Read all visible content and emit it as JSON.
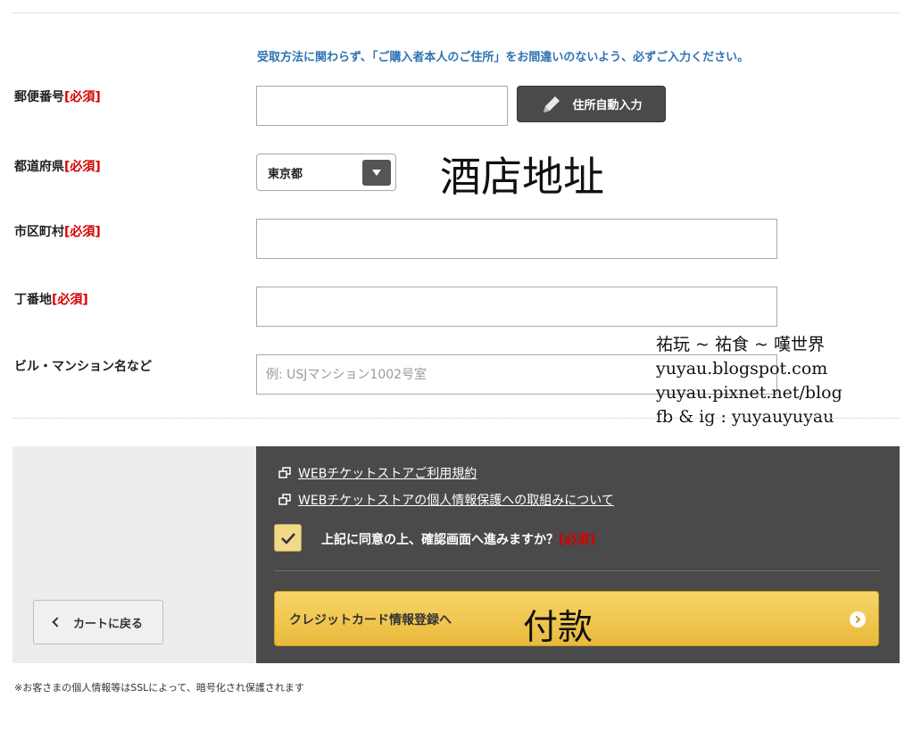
{
  "notice": "受取方法に関わらず、「ご購入者本人のご住所」をお間違いのないよう、必ずご入力ください。",
  "required_tag": "[必須]",
  "fields": {
    "postal": {
      "label": "郵便番号",
      "value": ""
    },
    "prefecture": {
      "label": "都道府県",
      "selected": "東京都"
    },
    "city": {
      "label": "市区町村",
      "value": ""
    },
    "street": {
      "label": "丁番地",
      "value": ""
    },
    "building": {
      "label": "ビル・マンション名など",
      "placeholder": "例: USJマンション1002号室",
      "value": ""
    }
  },
  "auto_fill_label": "住所自動入力",
  "annotations": {
    "hotel": "酒店地址",
    "pay": "付款"
  },
  "watermark": {
    "line1": "祐玩 ~ 祐食 ~ 嘆世界",
    "line2": "yuyau.blogspot.com",
    "line3": "yuyau.pixnet.net/blog",
    "line4": "fb & ig : yuyauyuyau"
  },
  "links": {
    "terms": "WEBチケットストアご利用規約",
    "privacy": "WEBチケットストアの個人情報保護への取組みについて"
  },
  "agree": {
    "label": "上記に同意の上、確認画面へ進みますか？",
    "required": "[必須]",
    "checked": true
  },
  "buttons": {
    "back": "カートに戻る",
    "next": "クレジットカード情報登録へ"
  },
  "ssl_note": "※お客さまの個人情報等はSSLによって、暗号化され保護されます",
  "colors": {
    "notice_blue": "#2f73b3",
    "required_red": "#d60000",
    "panel_dark": "#4a4a4a",
    "panel_gray": "#ededed",
    "cta_yellow": "#f7d667"
  }
}
